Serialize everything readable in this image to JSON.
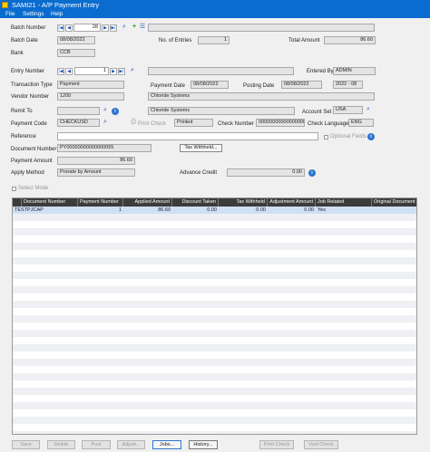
{
  "window": {
    "title": "SAMI21 - A/P Payment Entry"
  },
  "menu": {
    "file": "File",
    "settings": "Settings",
    "help": "Help"
  },
  "batch": {
    "number_label": "Batch Number",
    "number": "28",
    "date_label": "Batch Date",
    "date": "08/08/2022",
    "entries_label": "No. of Entries",
    "entries": "1",
    "total_label": "Total Amount",
    "total": "86.60",
    "bank_label": "Bank",
    "bank": "CCB"
  },
  "entry": {
    "number_label": "Entry Number",
    "number": "1",
    "entered_by_label": "Entered By",
    "entered_by": "ADMIN",
    "transaction_type_label": "Transaction Type",
    "transaction_type": "Payment",
    "payment_date_label": "Payment Date",
    "payment_date": "08/08/2022",
    "posting_date_label": "Posting Date",
    "posting_date": "08/08/2022",
    "year_period": "2022 - 08",
    "vendor_label": "Vendor Number",
    "vendor": "1200",
    "vendor_name": "Chloride Systems",
    "remit_label": "Remit To",
    "remit_name": "Chloride Systems",
    "account_set_label": "Account Set",
    "account_set": "USA",
    "payment_code_label": "Payment Code",
    "payment_code": "CHECKUSD",
    "print_check_label": "Print Check",
    "print_status": "Printed",
    "check_number_label": "Check Number",
    "check_number": "000000000000000002",
    "check_language_label": "Check Language",
    "check_language": "ENG",
    "reference_label": "Reference",
    "optional_fields_label": "Optional Fields",
    "document_label": "Document Number",
    "document": "PY00000000000000055",
    "tax_withheld_button": "Tax Withheld...",
    "payment_amount_label": "Payment Amount",
    "payment_amount": "86.60",
    "apply_method_label": "Apply Method",
    "apply_method": "Prorate by Amount",
    "advance_credit_label": "Advance Credit",
    "advance_credit": "0.00",
    "select_mode_label": "Select Mode"
  },
  "grid": {
    "columns": [
      "Document Number",
      "Payment Number",
      "Applied Amount",
      "Discount Taken",
      "Tax Withheld",
      "Adjustment Amount",
      "Job Related",
      "Original Document"
    ],
    "rows": [
      [
        "TESTPJCAP",
        "1",
        "86.60",
        "0.00",
        "0.00",
        "0.00",
        "Yes",
        ""
      ]
    ]
  },
  "buttons": {
    "save": "Save",
    "delete": "Delete",
    "post": "Post",
    "adjust": "Adjust...",
    "jobs": "Jobs...",
    "history": "History...",
    "print_check": "Print Check",
    "void_check": "Void Check"
  }
}
